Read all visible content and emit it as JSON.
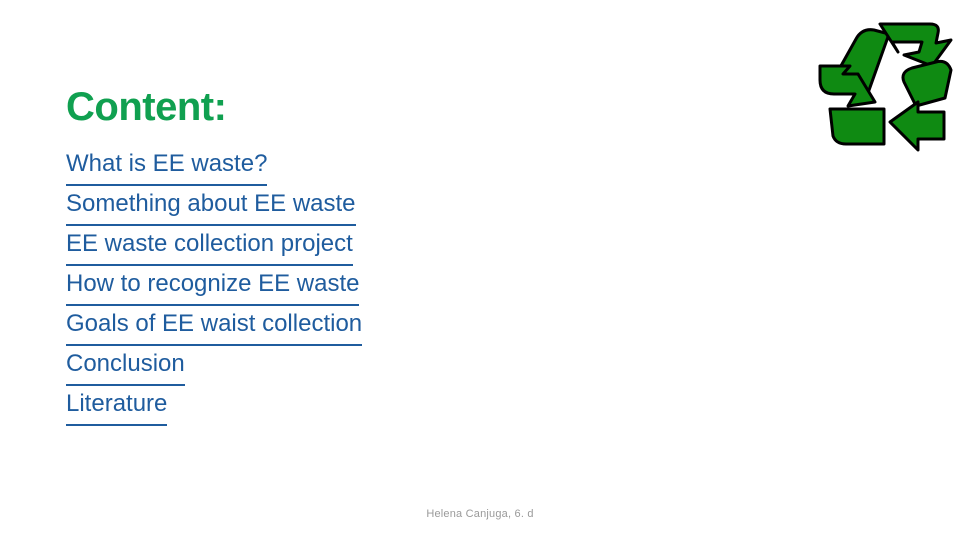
{
  "slide": {
    "title": "Content:",
    "background_color": "#ffffff",
    "title_color": "#10a050",
    "link_color": "#1f5c9e",
    "footer_color": "#9a9a9a",
    "logo_green": "#0f8a12",
    "logo_outline": "#000000"
  },
  "contents": {
    "items": [
      {
        "label": "What is EE waste?"
      },
      {
        "label": "Something about EE waste"
      },
      {
        "label": "EE waste collection project"
      },
      {
        "label": "How to recognize EE waste"
      },
      {
        "label": "Goals of EE waist collection"
      },
      {
        "label": "Conclusion"
      },
      {
        "label": "Literature"
      }
    ]
  },
  "footer": {
    "text": "Helena Canjuga, 6. d"
  },
  "logo": {
    "name": "recycling-symbol-icon"
  }
}
